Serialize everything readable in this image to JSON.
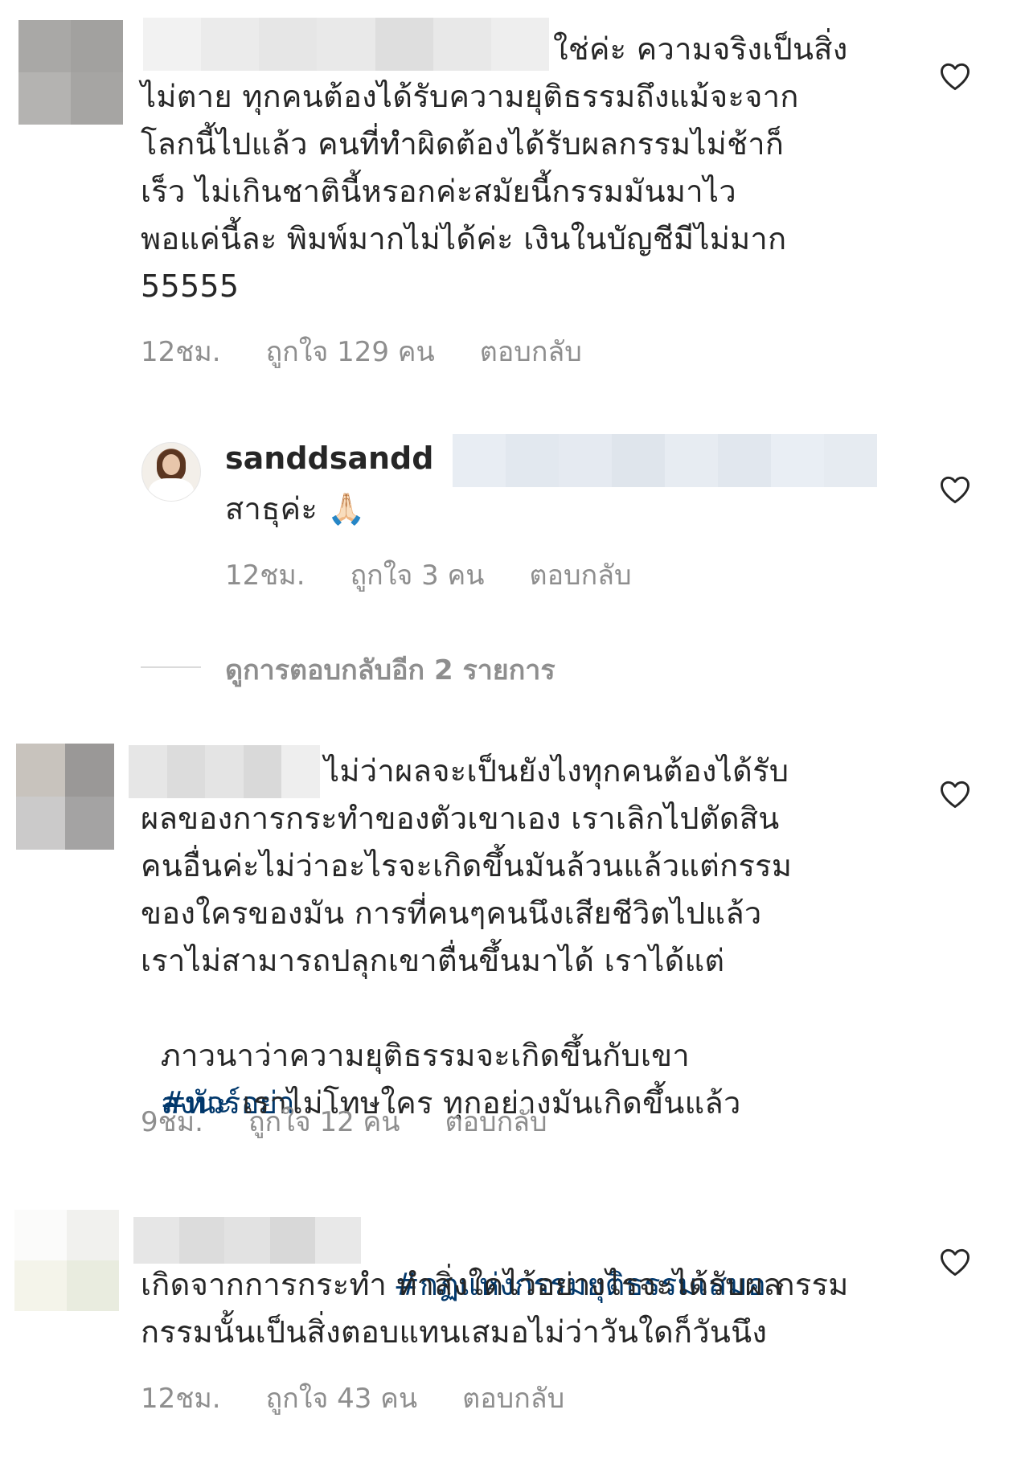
{
  "comments": [
    {
      "text_lines": [
        "ใช่ค่ะ ความจริงเป็นสิ่ง",
        "ไม่ตาย ทุกคนต้องได้รับความยุติธรรมถึงแม้จะจาก",
        "โลกนี้ไปแล้ว คนที่ทำผิดต้องได้รับผลกรรมไม่ช้าก็",
        "เร็ว ไม่เกินชาตินี้หรอกค่ะสมัยนี้กรรมมันมาไว",
        "พอแค่นี้ละ พิมพ์มากไม่ได้ค่ะ เงินในบัญชีมีไม่มาก",
        "55555"
      ],
      "time": "12ชม.",
      "likes": "ถูกใจ 129 คน",
      "reply": "ตอบกลับ"
    },
    {
      "username": "sanddsandd",
      "text": "สาธุค่ะ 🙏🏻",
      "time": "12ชม.",
      "likes": "ถูกใจ 3 คน",
      "reply": "ตอบกลับ"
    },
    {
      "view_replies": "ดูการตอบกลับอีก 2 รายการ"
    },
    {
      "text_lines": [
        "ไม่ว่าผลจะเป็นยังไงทุกคนต้องได้รับ",
        "ผลของการกระทำของตัวเขาเอง เราเลิกไปตัดสิน",
        "คนอื่นค่ะไม่ว่าอะไรจะเกิดขึ้นมันล้วนแล้วแต่กรรม",
        "ของใครของมัน การที่คนๆคนนึงเสียชีวิตไปแล้ว",
        "เราไม่สามารถปลุกเขาตื่นขึ้นมาได้ เราได้แต่",
        "ภาวนาว่าความยุติธรรมจะเกิดขึ้นกับเขา",
        "#ทัวร์อย่า",
        "ลงนะ",
        " เราไม่โทษใคร ทุกอย่างมันเกิดขึ้นแล้ว"
      ],
      "time": "9ชม.",
      "likes": "ถูกใจ 12 คน",
      "reply": "ตอบกลับ"
    },
    {
      "hashtag": "#กฏแห่งกรรมยุติธรรมเสมอ",
      "text_lines": [
        " กรรม",
        "เกิดจากการกระทำ ทำสิ่งใดไว้อย่างไรจะได้รับผล",
        "กรรมนั้นเป็นสิ่งตอบแทนเสมอไม่ว่าวันใดก็วันนึง"
      ],
      "time": "12ชม.",
      "likes": "ถูกใจ 43 คน",
      "reply": "ตอบกลับ"
    }
  ],
  "icons": {
    "like": "heart-outline-icon"
  },
  "colors": {
    "text": "#262626",
    "meta": "#8e8e8e",
    "hashtag": "#00376b"
  }
}
